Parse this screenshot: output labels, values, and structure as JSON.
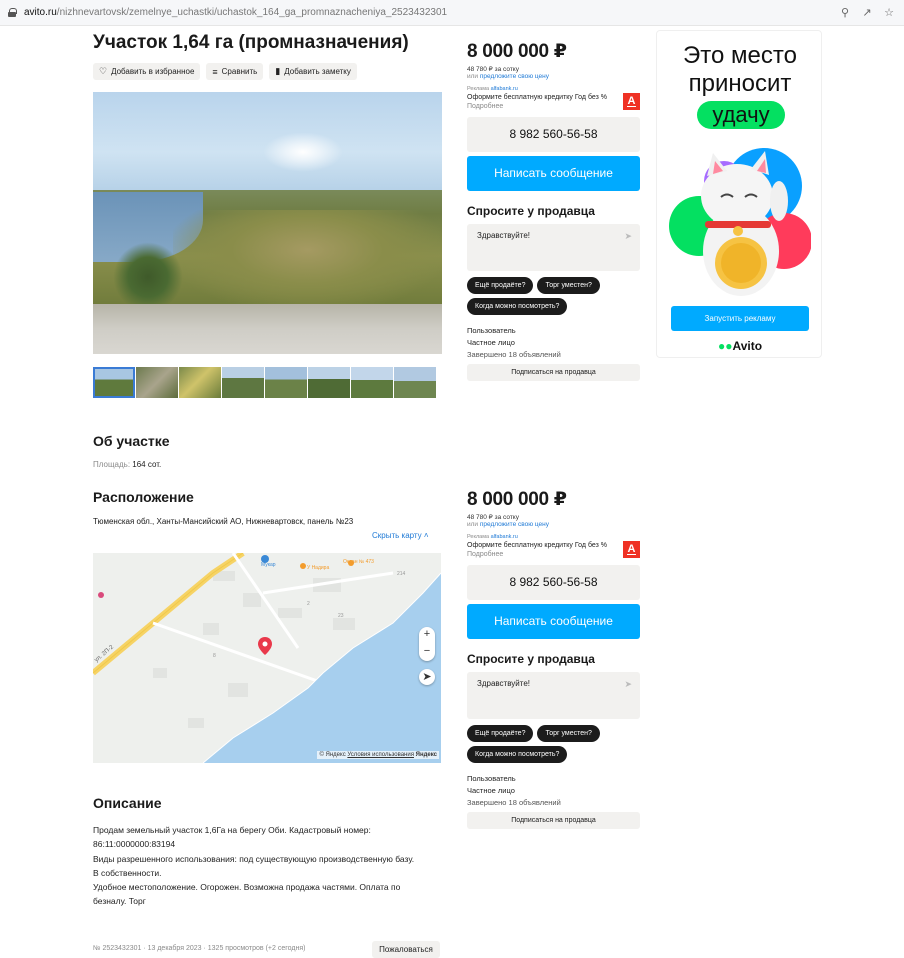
{
  "browser": {
    "url_domain": "avito.ru",
    "url_path": "/nizhnevartovsk/zemelnye_uchastki/uchastok_164_ga_promnaznacheniya_2523432301"
  },
  "listing": {
    "title": "Участок 1,64 га (промназначения)",
    "actions": [
      "Добавить в избранное",
      "Сравнить",
      "Добавить заметку"
    ]
  },
  "about": {
    "heading": "Об участке",
    "area_key": "Площадь:",
    "area_value": "164 сот."
  },
  "location": {
    "heading": "Расположение",
    "address": "Тюменская обл., Ханты-Мансийский АО, Нижневартовск, панель №23",
    "hide_map": "Скрыть карту",
    "map_copy_a": "© Яндекс",
    "map_copy_b": "Условия использования",
    "map_copy_c": "Яндекс",
    "map_labels": {
      "street": "ул. 2П-2",
      "poi1": "Мукар",
      "poi2": "У Надира",
      "poi3": "Океан № 473",
      "house_214": "214",
      "house_2": "2",
      "house_23": "23",
      "house_8": "8"
    }
  },
  "description": {
    "heading": "Описание",
    "lines": [
      "Продам земельный участок 1,6Га на берегу Оби. Кадастровый номер:",
      "86:11:0000000:83194",
      "Виды разрешенного использования: под существующую производственную базу.",
      "В собственности.",
      "Удобное местоположение. Огорожен. Возможна продажа частями. Оплата по",
      "безналу. Торг"
    ]
  },
  "footer": {
    "meta": "№ 2523432301 · 13 декабря 2023 · 1325 просмотров (+2 сегодня)",
    "complain": "Пожаловаться"
  },
  "seller_box": {
    "price": "8 000 000 ₽",
    "per_sotka": "48 780 ₽ за сотку",
    "offer_prefix": "или",
    "offer_link": "предложите свою цену",
    "ad_label": "Реклама",
    "ad_domain": "alfabank.ru",
    "credit_text": "Оформите бесплатную кредитку Год без %",
    "credit_more": "Подробнее",
    "alfa_letter": "А",
    "phone": "8 982 560-56-58",
    "write": "Написать сообщение",
    "ask_heading": "Спросите у продавца",
    "message_value": "Здравствуйте!",
    "quick_questions": [
      "Ещё продаёте?",
      "Торг уместен?",
      "Когда можно посмотреть?"
    ],
    "seller_name": "Пользователь",
    "seller_type": "Частное лицо",
    "seller_done": "Завершено 18 объявлений",
    "subscribe": "Подписаться на продавца"
  },
  "ad_banner": {
    "line1": "Это место",
    "line2": "приносит",
    "line3": "удачу",
    "button": "Запустить рекламу",
    "logo": "Avito"
  },
  "colors": {
    "accent_blue": "#00aaff",
    "link_blue": "#1f7ad6",
    "alfa_red": "#ef3124",
    "avito_green": "#04e061",
    "water": "#a7cfee",
    "map_pin": "#e9394b"
  },
  "icons": {
    "fav": "heart-icon",
    "compare": "compare-icon",
    "note": "note-icon",
    "send": "send-icon",
    "pin": "map-pin-icon"
  }
}
